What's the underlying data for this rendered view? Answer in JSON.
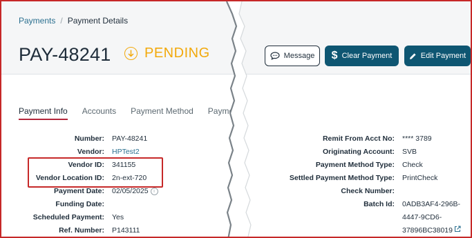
{
  "breadcrumb": {
    "parent": "Payments",
    "current": "Payment Details"
  },
  "header": {
    "payment_id": "PAY-48241",
    "status": "PENDING"
  },
  "actions": {
    "message": "Message",
    "clear_payment": "Clear Payment",
    "edit_payment": "Edit Payment"
  },
  "tabs": [
    "Payment Info",
    "Accounts",
    "Payment Method",
    "Paymen"
  ],
  "left_fields": [
    {
      "label": "Number:",
      "value": "PAY-48241"
    },
    {
      "label": "Vendor:",
      "value": "HPTest2"
    },
    {
      "label": "Vendor ID:",
      "value": "341155"
    },
    {
      "label": "Vendor Location ID:",
      "value": "2n-ext-720"
    },
    {
      "label": "Payment Date:",
      "value": "02/05/2025"
    },
    {
      "label": "Funding Date:",
      "value": ""
    },
    {
      "label": "Scheduled Payment:",
      "value": "Yes"
    },
    {
      "label": "Ref. Number:",
      "value": "P143111"
    }
  ],
  "right_fields": [
    {
      "label": "Remit From Acct No:",
      "value": "**** 3789"
    },
    {
      "label": "Originating Account:",
      "value": "SVB"
    },
    {
      "label": "Payment Method Type:",
      "value": "Check"
    },
    {
      "label": "Settled Payment Method Type:",
      "value": "PrintCheck"
    },
    {
      "label": "Check Number:",
      "value": ""
    },
    {
      "label": "Batch Id:",
      "value_lines": [
        "0ADB3AF4-296B-",
        "4447-9CD6-",
        "37896BC38019"
      ]
    }
  ],
  "colors": {
    "accent": "#0e5672",
    "pending": "#f2a90b",
    "link": "#2a6f8f",
    "tab_underline": "#b3263b",
    "highlight": "#c62828"
  },
  "icons": {
    "status": "arrow-down-circle-icon",
    "message": "chat-bubble-icon",
    "clear": "dollar-icon",
    "edit": "pencil-icon",
    "info": "info-icon",
    "external": "external-link-icon"
  }
}
